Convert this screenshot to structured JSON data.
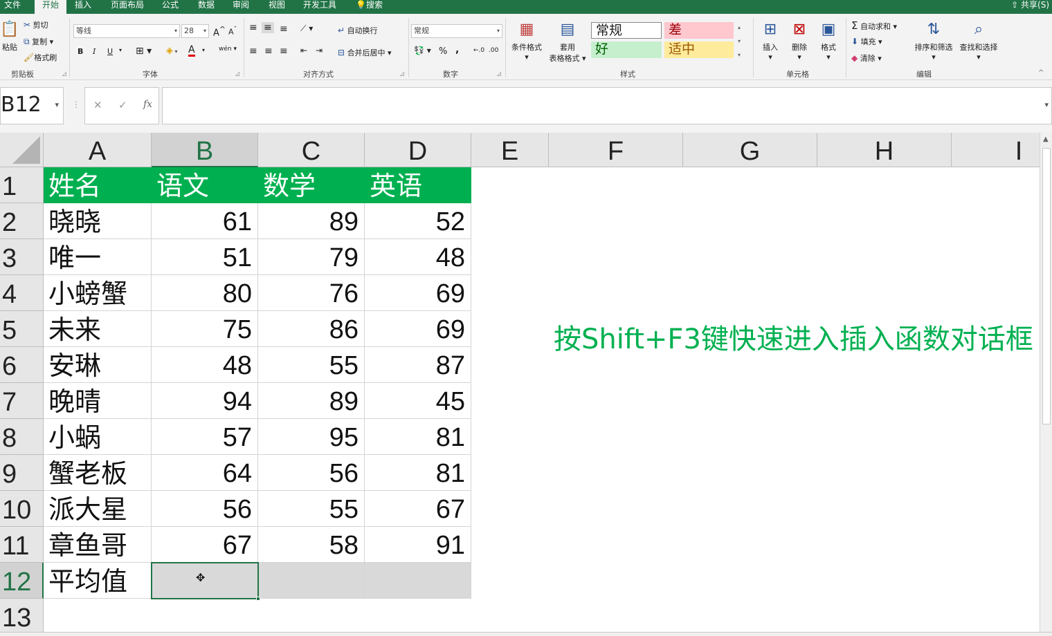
{
  "tabs": {
    "file": "文件",
    "home": "开始",
    "insert": "插入",
    "page_layout": "页面布局",
    "formulas": "公式",
    "data": "数据",
    "review": "审阅",
    "view": "视图",
    "developer": "开发工具",
    "search": "搜索",
    "share": "共享(S)"
  },
  "ribbon": {
    "clipboard": {
      "paste": "粘贴",
      "cut": "剪切",
      "copy": "复制",
      "format_painter": "格式刷",
      "label": "剪贴板"
    },
    "font": {
      "name": "等线",
      "size": "28",
      "bold": "B",
      "italic": "I",
      "underline": "U",
      "wen": "wén",
      "label": "字体"
    },
    "alignment": {
      "wrap_text": "自动换行",
      "merge_center": "合并后居中",
      "label": "对齐方式"
    },
    "number": {
      "format": "常规",
      "percent": "%",
      "comma": ",",
      "label": "数字"
    },
    "styles": {
      "conditional": "条件格式",
      "table_format_1": "套用",
      "table_format_2": "表格格式",
      "normal": "常规",
      "bad": "差",
      "good": "好",
      "neutral": "适中",
      "label": "样式"
    },
    "cells": {
      "insert": "插入",
      "delete": "删除",
      "format": "格式",
      "label": "单元格"
    },
    "editing": {
      "autosum": "自动求和",
      "fill": "填充",
      "clear": "清除",
      "sort_filter": "排序和筛选",
      "find_select": "查找和选择",
      "label": "编辑"
    }
  },
  "formula_bar": {
    "name_box": "B12",
    "formula": "",
    "fx": "fx"
  },
  "columns": [
    "A",
    "B",
    "C",
    "D",
    "E",
    "F",
    "G",
    "H",
    "I"
  ],
  "rows": [
    "1",
    "2",
    "3",
    "4",
    "5",
    "6",
    "7",
    "8",
    "9",
    "10",
    "11",
    "12",
    "13"
  ],
  "table": {
    "headers": [
      "姓名",
      "语文",
      "数学",
      "英语"
    ],
    "records": [
      [
        "晓晓",
        "61",
        "89",
        "52"
      ],
      [
        "唯一",
        "51",
        "79",
        "48"
      ],
      [
        "小螃蟹",
        "80",
        "76",
        "69"
      ],
      [
        "未来",
        "75",
        "86",
        "69"
      ],
      [
        "安琳",
        "48",
        "55",
        "87"
      ],
      [
        "晚晴",
        "94",
        "89",
        "45"
      ],
      [
        "小蜗",
        "57",
        "95",
        "81"
      ],
      [
        "蟹老板",
        "64",
        "56",
        "81"
      ],
      [
        "派大星",
        "56",
        "55",
        "67"
      ],
      [
        "章鱼哥",
        "67",
        "58",
        "91"
      ]
    ],
    "average_label": "平均值"
  },
  "note": "按Shift+F3键快速进入插入函数对话框",
  "colors": {
    "excel_green": "#217346",
    "header_fill": "#00b050",
    "note_color": "#00b050",
    "avg_fill": "#d9d9d9"
  }
}
